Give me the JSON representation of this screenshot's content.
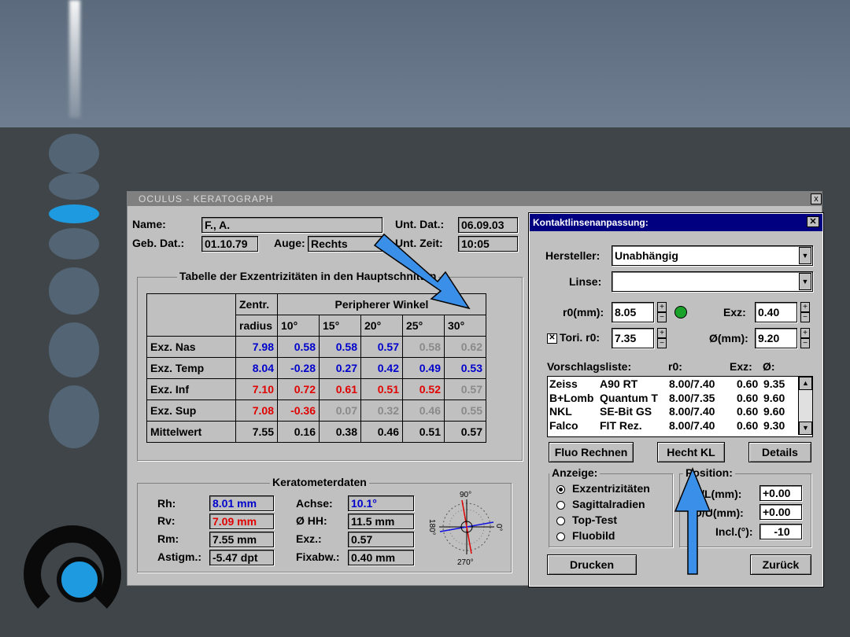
{
  "window": {
    "title": "OCULUS - KERATOGRAPH",
    "close_label": "x"
  },
  "patient": {
    "name_label": "Name:",
    "name_value": "F., A.",
    "birth_label": "Geb. Dat.:",
    "birth_value": "01.10.79",
    "eye_label": "Auge:",
    "eye_value": "Rechts",
    "exam_date_label": "Unt. Dat.:",
    "exam_date_value": "06.09.03",
    "exam_time_label": "Unt. Zeit:",
    "exam_time_value": "10:05"
  },
  "ecc_table": {
    "group_title": "Tabelle der Exzentrizitäten in den Hauptschnitten",
    "header_zentr": "Zentr.",
    "header_radius": "radius",
    "header_peripheral": "Peripherer Winkel",
    "angles": [
      "10°",
      "15°",
      "20°",
      "25°",
      "30°"
    ],
    "rows": [
      {
        "label": "Exz. Nas",
        "radius": "7.98",
        "radius_color": "blue",
        "values": [
          "0.58",
          "0.58",
          "0.57",
          "0.58",
          "0.62"
        ],
        "colors": [
          "blue",
          "blue",
          "blue",
          "gray",
          "gray"
        ]
      },
      {
        "label": "Exz. Temp",
        "radius": "8.04",
        "radius_color": "blue",
        "values": [
          "-0.28",
          "0.27",
          "0.42",
          "0.49",
          "0.53"
        ],
        "colors": [
          "blue",
          "blue",
          "blue",
          "blue",
          "blue"
        ]
      },
      {
        "label": "Exz. Inf",
        "radius": "7.10",
        "radius_color": "red",
        "values": [
          "0.72",
          "0.61",
          "0.51",
          "0.52",
          "0.57"
        ],
        "colors": [
          "red",
          "red",
          "red",
          "red",
          "gray"
        ]
      },
      {
        "label": "Exz. Sup",
        "radius": "7.08",
        "radius_color": "red",
        "values": [
          "-0.36",
          "0.07",
          "0.32",
          "0.46",
          "0.55"
        ],
        "colors": [
          "red",
          "gray",
          "gray",
          "gray",
          "gray"
        ]
      },
      {
        "label": "Mittelwert",
        "radius": "7.55",
        "radius_color": "black",
        "values": [
          "0.16",
          "0.38",
          "0.46",
          "0.51",
          "0.57"
        ],
        "colors": [
          "black",
          "black",
          "black",
          "black",
          "black"
        ]
      }
    ]
  },
  "kerato": {
    "group_title": "Keratometerdaten",
    "rh_label": "Rh:",
    "rh_value": "8.01 mm",
    "rv_label": "Rv:",
    "rv_value": "7.09 mm",
    "rm_label": "Rm:",
    "rm_value": "7.55 mm",
    "astig_label": "Astigm.:",
    "astig_value": "-5.47 dpt",
    "axis_label": "Achse:",
    "axis_value": "10.1°",
    "hh_label": "Ø HH:",
    "hh_value": "11.5 mm",
    "exz_label": "Exz.:",
    "exz_value": "0.57",
    "fix_label": "Fixabw.:",
    "fix_value": "0.40 mm",
    "compass": {
      "n": "90°",
      "s": "270°",
      "e": "0°",
      "w": "180°"
    }
  },
  "dialog": {
    "title": "Kontaktlinsenanpassung:",
    "manufacturer_label": "Hersteller:",
    "manufacturer_value": "Unabhängig",
    "lens_label": "Linse:",
    "lens_value": "",
    "r0_label": "r0(mm):",
    "r0_value": "8.05",
    "exz_label": "Exz:",
    "exz_value": "0.40",
    "tori_label": "Tori. r0:",
    "tori_value": "7.35",
    "tori_checked": true,
    "diam_label": "Ø(mm):",
    "diam_value": "9.20",
    "list_header": {
      "name": "Vorschlagsliste:",
      "r0": "r0:",
      "exz": "Exz:",
      "d": "Ø:"
    },
    "suggestions": [
      {
        "brand": "Zeiss",
        "model": "A90 RT",
        "r0": "8.00/7.40",
        "exz": "0.60",
        "d": "9.35"
      },
      {
        "brand": "B+Lomb",
        "model": "Quantum T",
        "r0": "8.00/7.35",
        "exz": "0.60",
        "d": "9.60"
      },
      {
        "brand": "NKL",
        "model": "SE-Bit GS",
        "r0": "8.00/7.40",
        "exz": "0.60",
        "d": "9.60"
      },
      {
        "brand": "Falco",
        "model": "FIT Rez.",
        "r0": "8.00/7.40",
        "exz": "0.60",
        "d": "9.30"
      }
    ],
    "btn_fluo": "Fluo Rechnen",
    "btn_hecht": "Hecht KL",
    "btn_details": "Details",
    "display_group": "Anzeige:",
    "display_options": [
      "Exzentrizitäten",
      "Sagittalradien",
      "Top-Test",
      "Fluobild"
    ],
    "display_selected": 0,
    "position_group": "Position:",
    "pos_rl_label": "R/L(mm):",
    "pos_rl_value": "+0.00",
    "pos_ou_label": "O/U(mm):",
    "pos_ou_value": "+0.00",
    "incl_label": "Incl.(°):",
    "incl_value": "-10",
    "btn_print": "Drucken",
    "btn_back": "Zurück"
  },
  "colors": {
    "blue": "#0000cc",
    "red": "#e00000",
    "gray": "#8a8a8a",
    "arrow": "#3a8fe8",
    "titlebar": "#000080"
  }
}
